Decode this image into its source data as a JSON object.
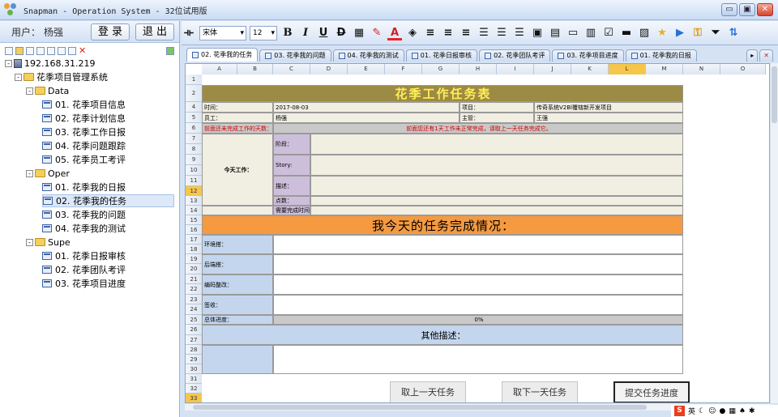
{
  "window": {
    "title": "Snapman - Operation System - 32位试用版",
    "min": "▭",
    "restore": "▣",
    "close": "✕"
  },
  "userbar": {
    "label": "用户：",
    "name": "杨强",
    "login": "登 录",
    "logout": "退 出"
  },
  "tree": {
    "server": "192.168.31.219",
    "system": "花季项目管理系统",
    "groups": [
      {
        "name": "Data",
        "items": [
          "01. 花季项目信息",
          "02. 花季计划信息",
          "03. 花季工作日报",
          "04. 花季问题跟踪",
          "05. 花季员工考评"
        ]
      },
      {
        "name": "Oper",
        "items": [
          "01. 花季我的日报",
          "02. 花季我的任务",
          "03. 花季我的问题",
          "04. 花季我的测试"
        ]
      },
      {
        "name": "Supe",
        "items": [
          "01. 花季日报审核",
          "02. 花季团队考评",
          "03. 花季项目进度"
        ]
      }
    ]
  },
  "toolbar": {
    "font": "宋体",
    "size": "12",
    "bold": "B",
    "italic": "I",
    "underline": "U",
    "strike": "D",
    "font_color": "A"
  },
  "tabs": [
    "02. 花季我的任务",
    "03. 花季我的问题",
    "04. 花季我的测试",
    "01. 花季日报审核",
    "02. 花季团队考评",
    "03. 花季项目进度",
    "01. 花季我的日报"
  ],
  "columns": [
    "A",
    "B",
    "C",
    "D",
    "E",
    "F",
    "G",
    "H",
    "I",
    "J",
    "K",
    "L",
    "M",
    "N",
    "O"
  ],
  "rows": [
    "1",
    "2",
    "4",
    "5",
    "6",
    "7",
    "8",
    "9",
    "10",
    "11",
    "12",
    "13",
    "14",
    "15",
    "16",
    "17",
    "18",
    "19",
    "20",
    "21",
    "22",
    "23",
    "24",
    "25",
    "26",
    "27",
    "28",
    "29",
    "30",
    "31",
    "32",
    "33",
    "34"
  ],
  "sheet": {
    "title": "花季工作任务表",
    "time_label": "时间：",
    "time_value": "2017-08-03",
    "project_label": "项目：",
    "project_value": "传奇系统V2Bl覆辖新开发项目",
    "staff_label": "员工：",
    "staff_value": "杨强",
    "manager_label": "主管：",
    "manager_value": "王强",
    "unfinished_label": "前面还未完成工作的天数：",
    "unfinished_msg": "前面您还有1天工作未正常完成，请取上一天任务完成它。",
    "today_label": "今天工作：",
    "stage_label": "阶段：",
    "story_label": "Story:",
    "desc_label": "描述：",
    "points_label": "点数：",
    "needtime_label": "需要完成时间：",
    "section_title": "我今天的任务完成情况：",
    "r18": "环境搭：",
    "r20": "后端搭：",
    "r22": "编码整改：",
    "r24": "签收：",
    "progress_label": "总体进度：",
    "progress_value": "0%",
    "other_title": "其他描述：",
    "btn_prev": "取上一天任务",
    "btn_next": "取下一天任务",
    "btn_submit": "提交任务进度"
  },
  "tray": {
    "ime": "S",
    "lang": "英"
  },
  "colors": {
    "title_bg": "#9c8b44",
    "title_fg": "#ffee55",
    "orange": "#f59a40"
  }
}
